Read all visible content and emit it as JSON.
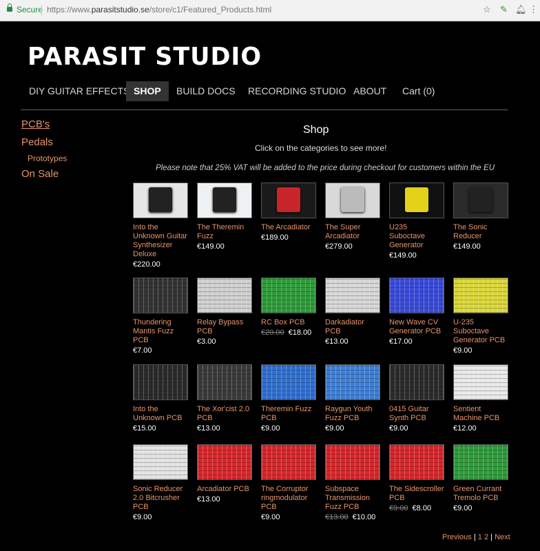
{
  "browser": {
    "secure_label": "Secure",
    "url_prefix": "https://www.",
    "url_domain": "parasitstudio.se",
    "url_path": "/store/c1/Featured_Products.html"
  },
  "site": {
    "logo": "PARASIT STUDIO"
  },
  "nav": [
    {
      "label": "DIY GUITAR EFFECTS"
    },
    {
      "label": "SHOP"
    },
    {
      "label": "BUILD DOCS"
    },
    {
      "label": "RECORDING STUDIO"
    },
    {
      "label": "ABOUT"
    },
    {
      "label": "Cart (0)"
    }
  ],
  "sidebar": [
    {
      "label": "PCB's"
    },
    {
      "label": "Pedals"
    },
    {
      "label": "Prototypes"
    },
    {
      "label": "On Sale"
    }
  ],
  "main": {
    "title": "Shop",
    "subtitle": "Click on the categories to see more!",
    "note": "Please note that 25% VAT will be added to the price during checkout for customers within the EU"
  },
  "products": [
    {
      "name": "Into the Unknown Guitar Synthesizer Deluxe",
      "price": "€220.00",
      "old_price": "",
      "bg": "#e6e6e6"
    },
    {
      "name": "The Theremin Fuzz",
      "price": "€149.00",
      "old_price": "",
      "bg": "#eef1f4"
    },
    {
      "name": "The Arcadiator",
      "price": "€189.00",
      "old_price": "",
      "bg": "#1a1a1a"
    },
    {
      "name": "The Super Arcadiator",
      "price": "€279.00",
      "old_price": "",
      "bg": "#d9d9d9"
    },
    {
      "name": "U235 Suboctave Generator",
      "price": "€149.00",
      "old_price": "",
      "bg": "#111"
    },
    {
      "name": "The Sonic Reducer",
      "price": "€149.00",
      "old_price": "",
      "bg": "#2a2a2a"
    },
    {
      "name": "Thundering Mantis Fuzz PCB",
      "price": "€7.00",
      "old_price": "",
      "bg": "#333"
    },
    {
      "name": "Relay Bypass PCB",
      "price": "€3.00",
      "old_price": "",
      "bg": "#cfcfcf"
    },
    {
      "name": "RC Box PCB",
      "price": "€18.00",
      "old_price": "€20.00",
      "bg": "#2e9b3a"
    },
    {
      "name": "Darkadiator PCB",
      "price": "€13.00",
      "old_price": "",
      "bg": "#d6d6d6"
    },
    {
      "name": "New Wave CV Generator PCB",
      "price": "€17.00",
      "old_price": "",
      "bg": "#3a4bd6"
    },
    {
      "name": "U-235 Suboctave Generator PCB",
      "price": "€9.00",
      "old_price": "",
      "bg": "#d9d63a"
    },
    {
      "name": "Into the Unknown PCB",
      "price": "€15.00",
      "old_price": "",
      "bg": "#2a2a2a"
    },
    {
      "name": "The Xor'cist 2.0 PCB",
      "price": "€13.00",
      "old_price": "",
      "bg": "#3a3a3a"
    },
    {
      "name": "Theremin Fuzz PCB",
      "price": "€9.00",
      "old_price": "",
      "bg": "#2f6fd1"
    },
    {
      "name": "Raygun Youth Fuzz PCB",
      "price": "€9.00",
      "old_price": "",
      "bg": "#3d7ed6"
    },
    {
      "name": "0415 Guitar Synth PCB",
      "price": "€9.00",
      "old_price": "",
      "bg": "#2b2b2b"
    },
    {
      "name": "Sentient Machine PCB",
      "price": "€12.00",
      "old_price": "",
      "bg": "#e8e8e8"
    },
    {
      "name": "Sonic Reducer 2.0 Bitcrusher PCB",
      "price": "€9.00",
      "old_price": "",
      "bg": "#e2e2e2"
    },
    {
      "name": "Arcadiator PCB",
      "price": "€13.00",
      "old_price": "",
      "bg": "#d8262a"
    },
    {
      "name": "The Corruptor ringmodulator PCB",
      "price": "€9.00",
      "old_price": "",
      "bg": "#d8262a"
    },
    {
      "name": "Subspace Transmission Fuzz PCB",
      "price": "€10.00",
      "old_price": "€13.00",
      "bg": "#d8262a"
    },
    {
      "name": "The Sidescroller PCB",
      "price": "€8.00",
      "old_price": "€9.00",
      "bg": "#d8262a"
    },
    {
      "name": "Green Currant Tremolo PCB",
      "price": "€9.00",
      "old_price": "",
      "bg": "#2e9b3a"
    }
  ],
  "pagination": {
    "previous": "Previous",
    "sep1": "|",
    "page1": "1",
    "page2": "2",
    "sep2": "|",
    "next": "Next"
  }
}
